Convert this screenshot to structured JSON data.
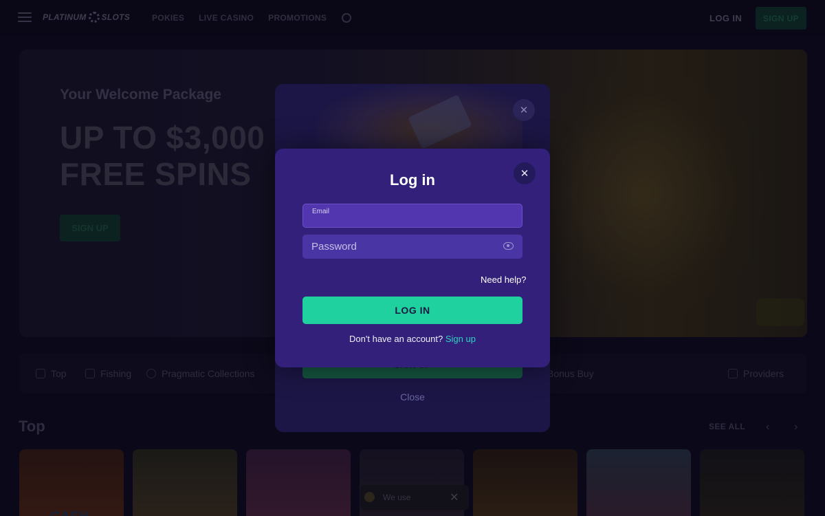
{
  "header": {
    "logo_left": "PLATINUM",
    "logo_right": "SLOTS",
    "nav": [
      "POKIES",
      "LIVE CASINO",
      "PROMOTIONS"
    ],
    "login_label": "LOG IN",
    "signup_label": "SIGN UP"
  },
  "hero": {
    "subtitle": "Your Welcome Package",
    "title_line1": "UP TO $3,000 +",
    "title_line2": "FREE SPINS",
    "cta_label": "SIGN UP"
  },
  "categories": {
    "items": [
      "Top",
      "Fishing",
      "Pragmatic Collections",
      "Bonus Buy"
    ],
    "providers_label": "Providers"
  },
  "games_section": {
    "title": "Top",
    "see_all": "SEE ALL",
    "prev_icon": "‹",
    "next_icon": "›",
    "first_tile_text": "CASH"
  },
  "cookie_banner": {
    "text": "We use",
    "close_icon": "✕"
  },
  "signup_modal_back": {
    "button_label": "SIGN UP",
    "close_link": "Close",
    "close_icon": "✕"
  },
  "login_modal": {
    "title": "Log in",
    "close_icon": "✕",
    "email_label": "Email",
    "email_value": "",
    "password_placeholder": "Password",
    "need_help": "Need help?",
    "login_button": "LOG IN",
    "no_account_text": "Don't have an account?",
    "signup_link": "Sign up"
  },
  "colors": {
    "accent_green": "#1fd19e",
    "modal_bg": "#32207a",
    "link_teal": "#2fd4c0"
  }
}
